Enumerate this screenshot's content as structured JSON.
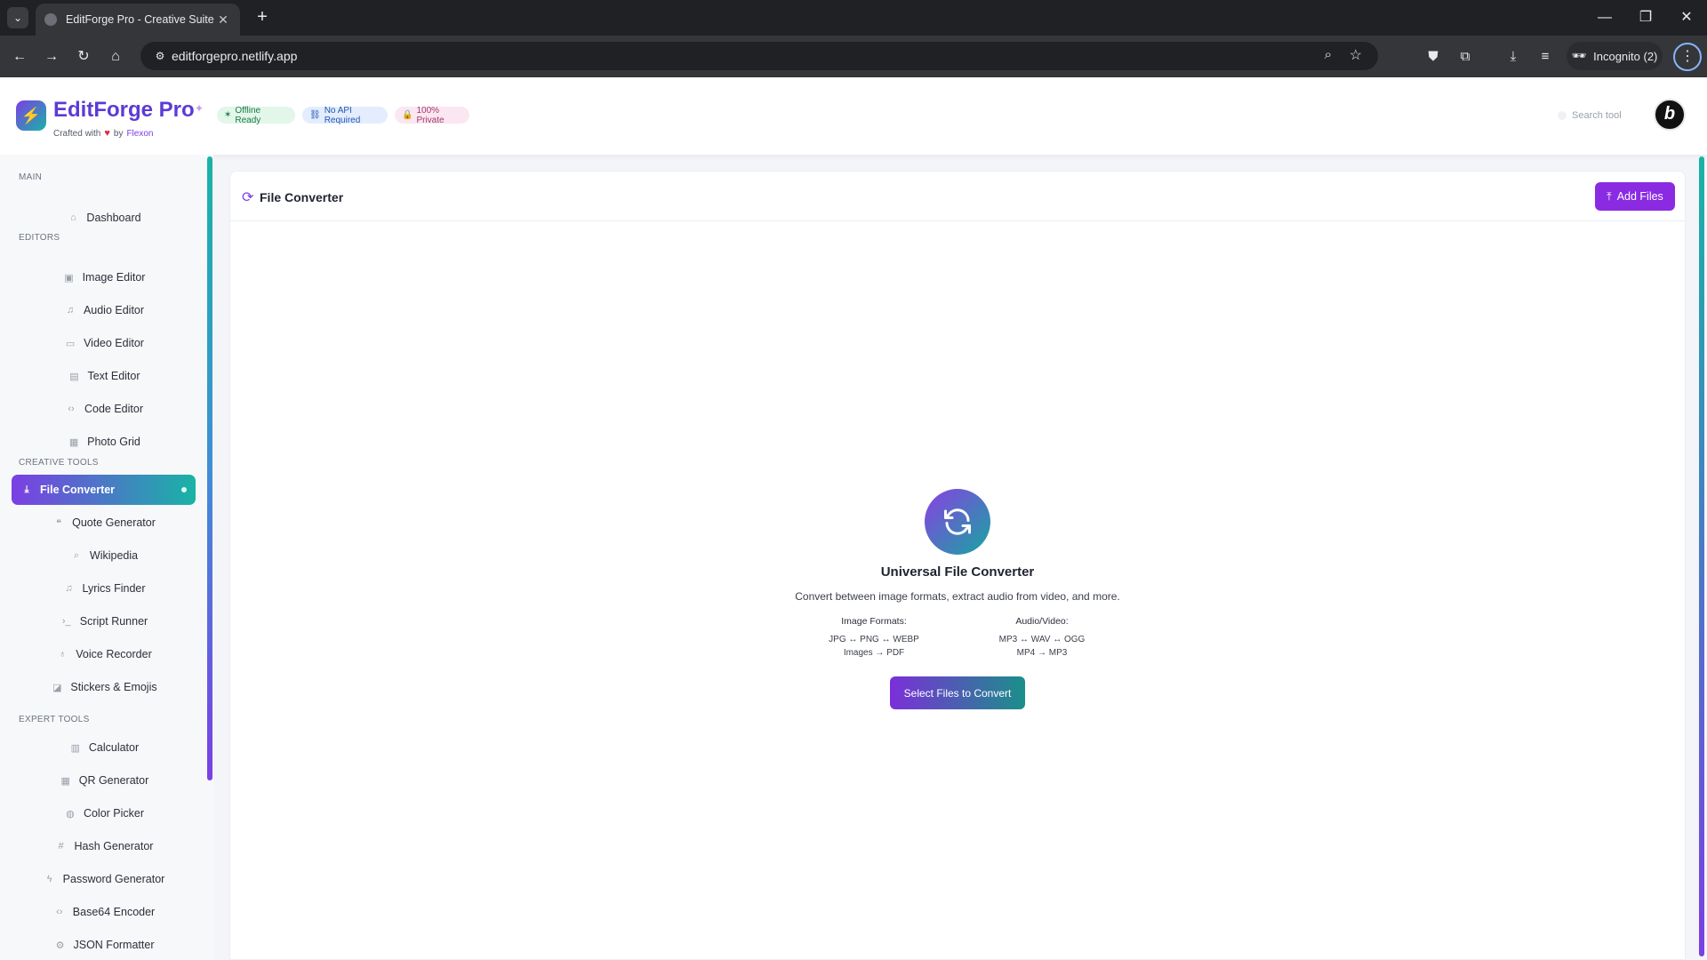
{
  "browser": {
    "tab_title": "EditForge Pro - Creative Suite",
    "url": "editforgepro.netlify.app",
    "incognito_label": "Incognito (2)"
  },
  "header": {
    "brand": "EditForge Pro",
    "crafted_prefix": "Crafted with",
    "crafted_by": "by",
    "author": "Flexon",
    "badges": [
      "Offline Ready",
      "No API Required",
      "100% Private"
    ],
    "search_placeholder": "Search tool",
    "avatar_letter": "b"
  },
  "sidebar": {
    "sections": {
      "main": "MAIN",
      "editors": "EDITORS",
      "creative": "CREATIVE TOOLS",
      "expert": "EXPERT TOOLS"
    },
    "items": {
      "dashboard": "Dashboard",
      "image_editor": "Image Editor",
      "audio_editor": "Audio Editor",
      "video_editor": "Video Editor",
      "text_editor": "Text Editor",
      "code_editor": "Code Editor",
      "photo_grid": "Photo Grid",
      "file_converter": "File Converter",
      "quote_generator": "Quote Generator",
      "wikipedia": "Wikipedia",
      "lyrics_finder": "Lyrics Finder",
      "script_runner": "Script Runner",
      "voice_recorder": "Voice Recorder",
      "stickers": "Stickers & Emojis",
      "calculator": "Calculator",
      "qr_generator": "QR Generator",
      "color_picker": "Color Picker",
      "hash_generator": "Hash Generator",
      "password_generator": "Password Generator",
      "base64_encoder": "Base64 Encoder",
      "json_formatter": "JSON Formatter"
    }
  },
  "main": {
    "title": "File Converter",
    "add_files": "Add Files",
    "hero_title": "Universal File Converter",
    "hero_desc": "Convert between image formats, extract audio from video, and more.",
    "image_formats_head": "Image Formats:",
    "image_formats_1": "JPG ↔ PNG ↔ WEBP",
    "image_formats_2": "Images → PDF",
    "av_head": "Audio/Video:",
    "av_1": "MP3 ↔ WAV ↔ OGG",
    "av_2": "MP4 → MP3",
    "select_button": "Select Files to Convert"
  },
  "colors": {
    "accent_purple": "#7b3fe4",
    "accent_teal": "#19b3a6"
  }
}
